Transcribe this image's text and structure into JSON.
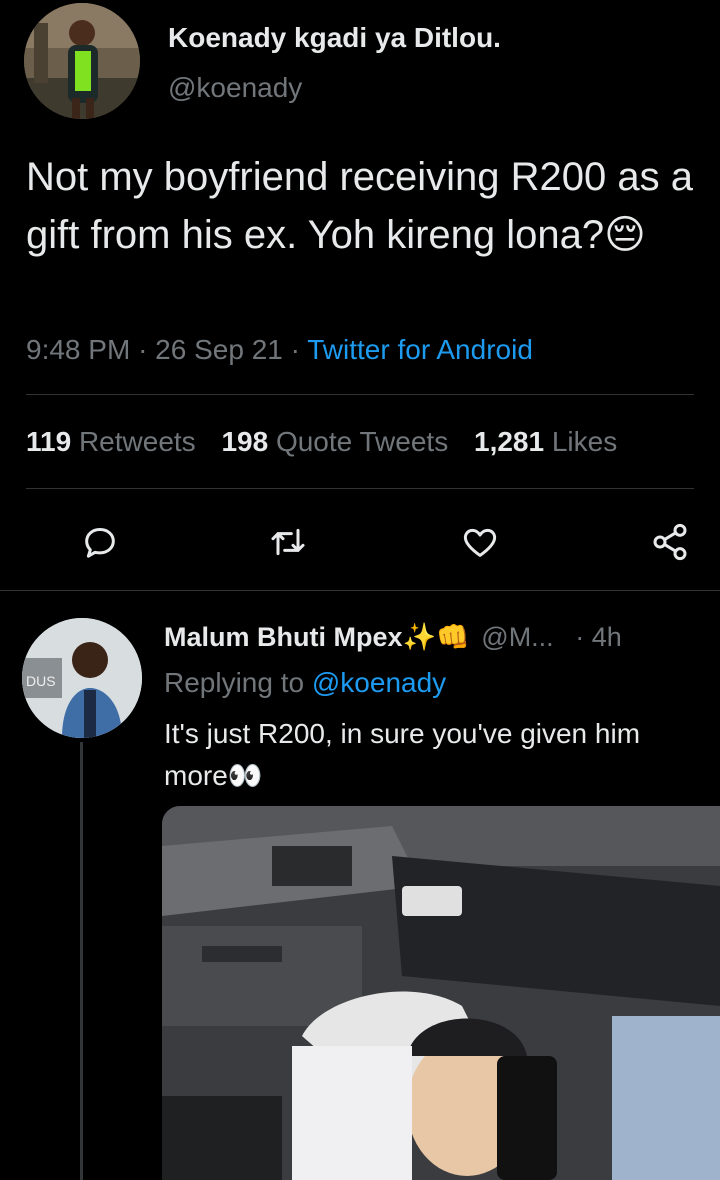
{
  "tweet": {
    "author_name": "Koenady kgadi ya Ditlou.",
    "author_handle": "@koenady",
    "text": "Not my boyfriend receiving R200 as a gift from his ex. Yoh kireng lona?",
    "emoji": "😔",
    "time": "9:48 PM",
    "date": "26 Sep 21",
    "sep1": "·",
    "sep2": "·",
    "source": "Twitter for Android",
    "stats": {
      "retweets_count": "119",
      "retweets_label": "Retweets",
      "quotes_count": "198",
      "quotes_label": "Quote Tweets",
      "likes_count": "1,281",
      "likes_label": "Likes"
    },
    "actions": [
      "reply-icon",
      "retweet-icon",
      "like-icon",
      "share-icon"
    ]
  },
  "reply": {
    "author_name": "Malum Bhuti Mpex",
    "badges": "✨👊",
    "author_handle": "@M...",
    "time": "· 4h",
    "replying_prefix": "Replying to",
    "replying_handle": "@koenady",
    "text": "It's just R200, in sure you've given him more",
    "emoji": "👀"
  },
  "colors": {
    "background": "#000000",
    "text": "#e7e9ea",
    "muted": "#71767b",
    "accent": "#1d9bf0",
    "divider": "#2f3336"
  }
}
